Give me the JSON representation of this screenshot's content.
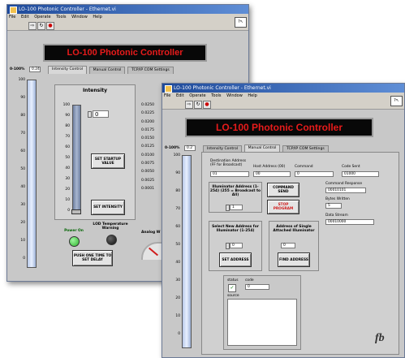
{
  "back_window": {
    "title": "LO-100 Photonic Controller - Ethernet.vi",
    "menu": [
      "File",
      "Edit",
      "Operate",
      "Tools",
      "Window",
      "Help"
    ],
    "banner": "LO-100 Photonic Controller",
    "scale_label": "0-100%",
    "scale_value": "0.24",
    "tabs": [
      "Intensity Control",
      "Manual Control",
      "TCP/IP COM Settings"
    ],
    "active_tab": 0,
    "slider_scale": [
      "100",
      "90",
      "80",
      "70",
      "60",
      "50",
      "40",
      "30",
      "20",
      "10",
      "0"
    ],
    "intensity_label": "Intensity",
    "intensity_scale": [
      "100",
      "90",
      "80",
      "70",
      "60",
      "50",
      "40",
      "30",
      "20",
      "10",
      "0"
    ],
    "intensity_value": "0",
    "buttons": {
      "set_startup": "SET STARTUP VALUE",
      "set_intensity": "SET INTENSITY"
    },
    "readout_values": [
      "0.0250",
      "0.0225",
      "0.0200",
      "0.0175",
      "0.0150",
      "0.0125",
      "0.0100",
      "0.0075",
      "0.0050",
      "0.0025",
      "0.0001"
    ],
    "indicators": {
      "power_on": "Power On",
      "temp_warning": "LOD Temperature Warning",
      "analog": "Analog W"
    },
    "push_once": "PUSH ONE TIME TO SET DELAY",
    "colors": {
      "power_led": "#2fb52f",
      "temp_led": "#111111",
      "banner_text": "#e81b1b"
    }
  },
  "front_window": {
    "title": "LO-100 Photonic Controller - Ethernet.vi",
    "menu": [
      "File",
      "Edit",
      "Operate",
      "Tools",
      "Window",
      "Help"
    ],
    "banner": "LO-100 Photonic Controller",
    "scale_label": "0-100%",
    "scale_value": "0.2",
    "tabs": [
      "Intensity Control",
      "Manual Control",
      "TCP/IP COM Settings"
    ],
    "active_tab": 1,
    "slider_scale": [
      "100",
      "90",
      "80",
      "70",
      "60",
      "50",
      "40",
      "30",
      "20",
      "10",
      "0"
    ],
    "destination": {
      "label": "Destination Address (FF for Broadcast)",
      "value": "01"
    },
    "host": {
      "label": "Host Address (00)",
      "value": "00"
    },
    "command": {
      "label": "Command",
      "value": "0"
    },
    "code_sent": {
      "label": "Code Sent",
      "value": "01000"
    },
    "illuminator": {
      "label": "Illuminator Address (1-254) (255 = Broadcast to All)",
      "value": "1"
    },
    "command_send": "COMMAND SEND",
    "stop_program": "STOP PROGRAM",
    "command_response": {
      "label": "Command Response",
      "value": "00010101"
    },
    "bytes_written": {
      "label": "Bytes Written",
      "value": "5"
    },
    "data_stream": {
      "label": "Data Stream",
      "value": "00010000"
    },
    "select_new": {
      "label": "Select New Address for Illuminator (1-254)",
      "value": "0",
      "button": "SET ADDRESS"
    },
    "single_attached": {
      "label": "Address of Single Attached Illuminator",
      "value": "0",
      "button": "FIND ADDRESS"
    },
    "status_group": {
      "status_label": "status",
      "code_label": "code",
      "code_value": "0",
      "source_label": "source"
    },
    "logo": "fb"
  }
}
